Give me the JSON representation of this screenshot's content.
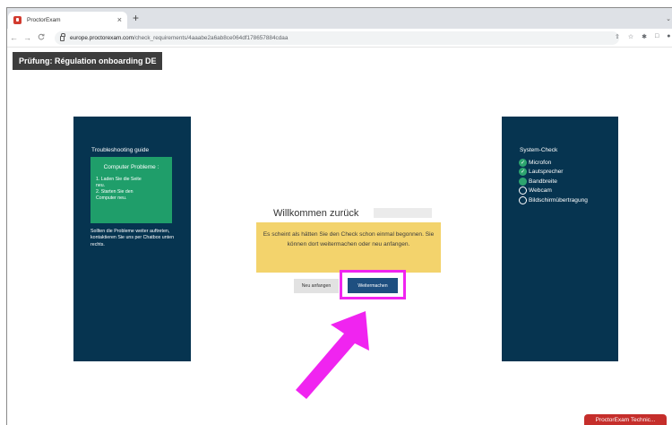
{
  "browser": {
    "tab_title": "ProctorExam",
    "tab_close": "×",
    "new_tab": "+",
    "tab_menu": "⌄",
    "nav_back": "←",
    "nav_forward": "→",
    "nav_reload": "C",
    "url_host": "europe.proctorexam.com",
    "url_path": "/check_requirements/4aaabe2a6ab8ce064df178657884cdaa",
    "omnibox_icons": [
      "share-icon",
      "star-icon",
      "extensions-icon",
      "sidepanel-icon",
      "profile-icon",
      "menu-icon"
    ]
  },
  "exam": {
    "title": "Prüfung: Régulation onboarding DE"
  },
  "troubleshooting": {
    "heading": "Troubleshooting guide",
    "box_title": "Computer Probleme :",
    "box_body": "1. Laden Sie die Seite\nneu.\n2. Starten Sie den\nComputer neu.",
    "note": "Sollten die Probleme weiter auftreten, kontaktieren Sie uns per Chatbox unten rechts."
  },
  "system_check": {
    "heading": "System-Check",
    "items": [
      {
        "label": "Microfon",
        "status": "ok"
      },
      {
        "label": "Lautsprecher",
        "status": "ok"
      },
      {
        "label": "Bandbreite",
        "status": "running"
      },
      {
        "label": "Webcam",
        "status": "pending"
      },
      {
        "label": "Bildschirmübertragung",
        "status": "pending"
      }
    ]
  },
  "main": {
    "welcome": "Willkommen zurück",
    "notice": "Es scheint als hätten Sie den Check schon einmal begonnen. Sie können dort weitermachen oder neu anfangen.",
    "restart_label": "Neu anfangen",
    "continue_label": "Weitermachen"
  },
  "chat": {
    "label": "ProctorExam Technic..."
  },
  "colors": {
    "panel": "#063450",
    "green": "#1f9e6a",
    "notice": "#f3d36c",
    "highlight": "#f024f0",
    "continue": "#1e4f80",
    "chat": "#c52e2b"
  }
}
